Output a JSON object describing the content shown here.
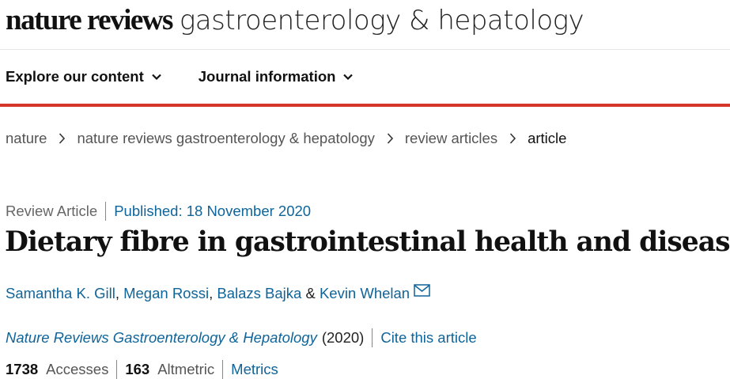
{
  "masthead": {
    "brand_bold": "nature reviews",
    "brand_light": "gastroenterology & hepatology"
  },
  "nav": {
    "items": [
      {
        "label": "Explore our content"
      },
      {
        "label": "Journal information"
      }
    ]
  },
  "breadcrumb": [
    {
      "label": "nature"
    },
    {
      "label": "nature reviews gastroenterology & hepatology"
    },
    {
      "label": "review articles"
    },
    {
      "label": "article"
    }
  ],
  "article": {
    "type": "Review Article",
    "published": "Published: 18 November 2020",
    "title": "Dietary fibre in gastrointestinal health and disease",
    "authors": [
      "Samantha K. Gill",
      "Megan Rossi",
      "Balazs Bajka",
      "Kevin Whelan"
    ],
    "author_separators": [
      ", ",
      ", ",
      " & "
    ],
    "journal": "Nature Reviews Gastroenterology & Hepatology",
    "year": "(2020)",
    "cite_label": "Cite this article",
    "accesses": "1738",
    "accesses_label": "Accesses",
    "altmetric": "163",
    "altmetric_label": "Altmetric",
    "metrics_label": "Metrics"
  },
  "colors": {
    "accent_red": "#d6372b",
    "link_blue": "#0f6499"
  }
}
